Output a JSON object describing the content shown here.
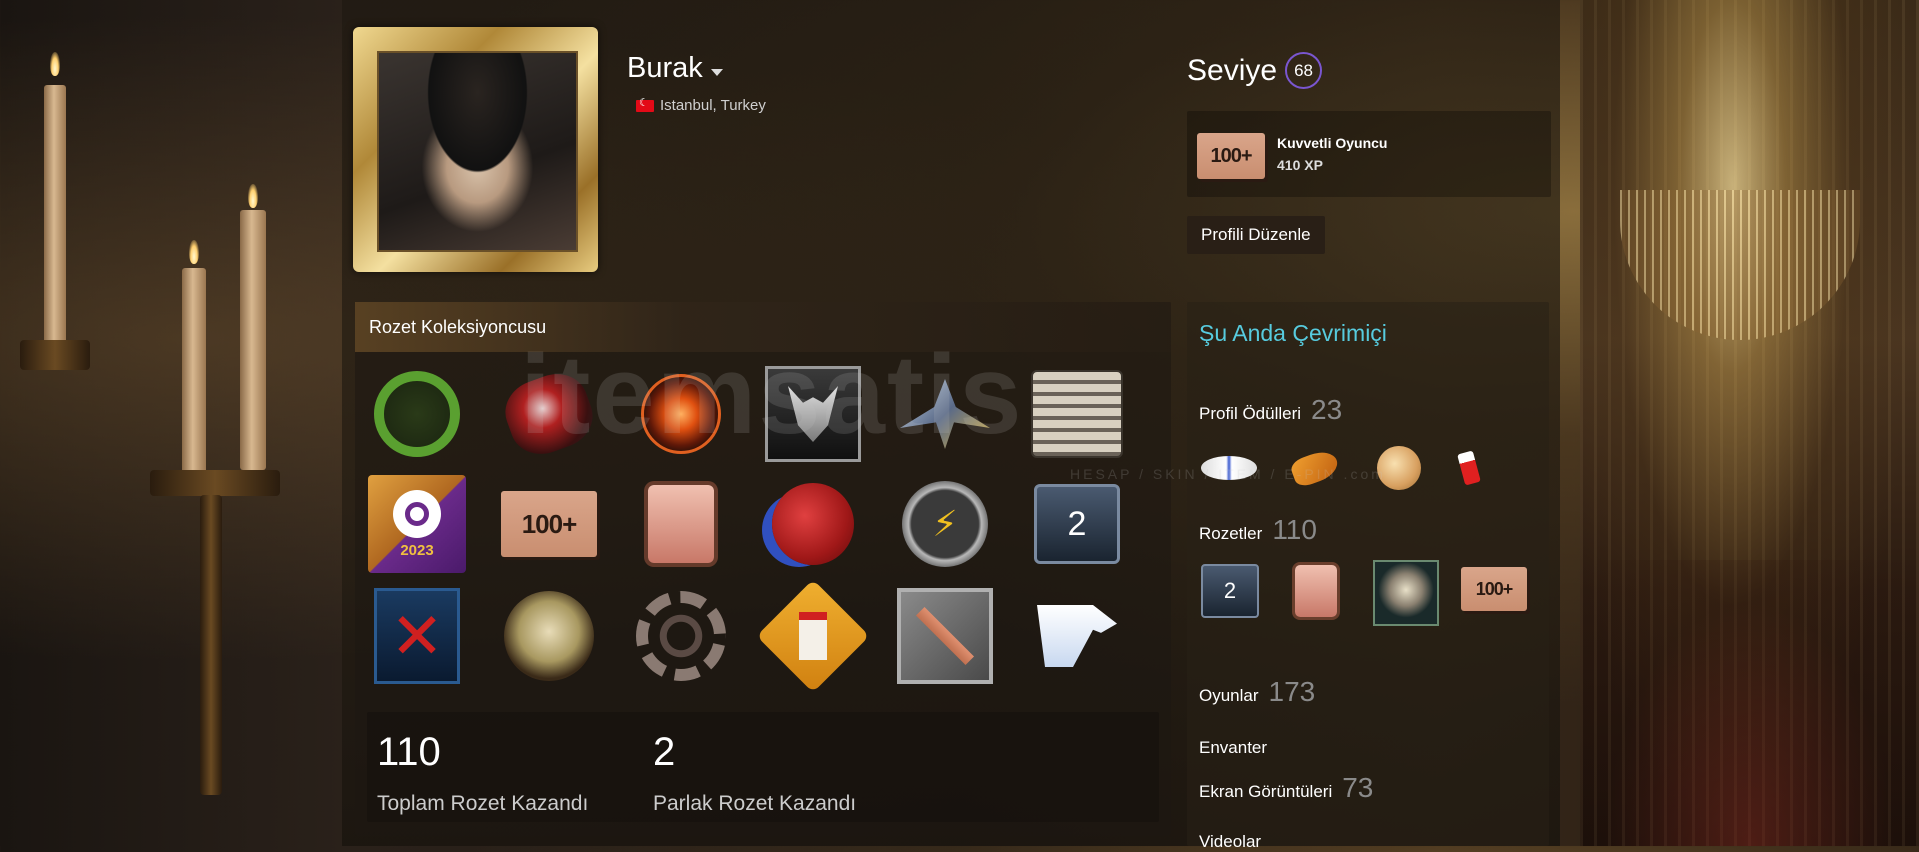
{
  "profile": {
    "name": "Burak",
    "location": "Istanbul, Turkey"
  },
  "level": {
    "label": "Seviye",
    "value": "68"
  },
  "xp": {
    "badge_text": "100+",
    "name": "Kuvvetli Oyuncu",
    "value": "410 XP"
  },
  "edit_profile_label": "Profili Düzenle",
  "showcase": {
    "title": "Rozet Koleksiyoncusu",
    "badges": [
      {
        "icon": "laurel-wreath-icon"
      },
      {
        "icon": "crystal-orb-icon"
      },
      {
        "icon": "magic-circle-icon"
      },
      {
        "icon": "wolf-medallion-icon"
      },
      {
        "icon": "spaceship-icon"
      },
      {
        "icon": "cash-register-icon"
      },
      {
        "icon": "steam-2023-icon",
        "text": "2023"
      },
      {
        "icon": "level-100-plus-icon",
        "text": "100+"
      },
      {
        "icon": "gift-box-icon"
      },
      {
        "icon": "wax-seal-icon"
      },
      {
        "icon": "lightning-coin-icon"
      },
      {
        "icon": "number-card-icon",
        "text": "2"
      },
      {
        "icon": "crossed-card-icon"
      },
      {
        "icon": "steampunk-mask-icon"
      },
      {
        "icon": "gear-wheel-icon"
      },
      {
        "icon": "milk-carton-sign-icon"
      },
      {
        "icon": "hammer-icon"
      },
      {
        "icon": "eagle-head-icon"
      }
    ],
    "stats": [
      {
        "value": "110",
        "label": "Toplam Rozet Kazandı"
      },
      {
        "value": "2",
        "label": "Parlak Rozet Kazandı"
      }
    ]
  },
  "sidebar": {
    "online": "Şu Anda Çevrimiçi",
    "rewards_label": "Profil Ödülleri",
    "rewards_count": "23",
    "rewards_icons": [
      "winged-badge-icon",
      "orange-fish-icon",
      "camel-head-icon",
      "red-bottle-icon"
    ],
    "badges_label": "Rozetler",
    "badges_count": "110",
    "badges_icons": [
      {
        "icon": "number-card-icon",
        "text": "2"
      },
      {
        "icon": "gift-box-icon"
      },
      {
        "icon": "skull-icon"
      },
      {
        "icon": "level-100-plus-icon",
        "text": "100+"
      }
    ],
    "games_label": "Oyunlar",
    "games_count": "173",
    "inventory_label": "Envanter",
    "screenshots_label": "Ekran Görüntüleri",
    "screenshots_count": "73",
    "videos_label": "Videolar"
  },
  "watermark": {
    "logo": "itemsatis",
    "tagline": "HESAP / SKIN / ITEM / E-PIN .com"
  },
  "colors": {
    "online": "#57cbde",
    "level_ring": "#7a56d0",
    "badge_100": "#d9a58a"
  }
}
